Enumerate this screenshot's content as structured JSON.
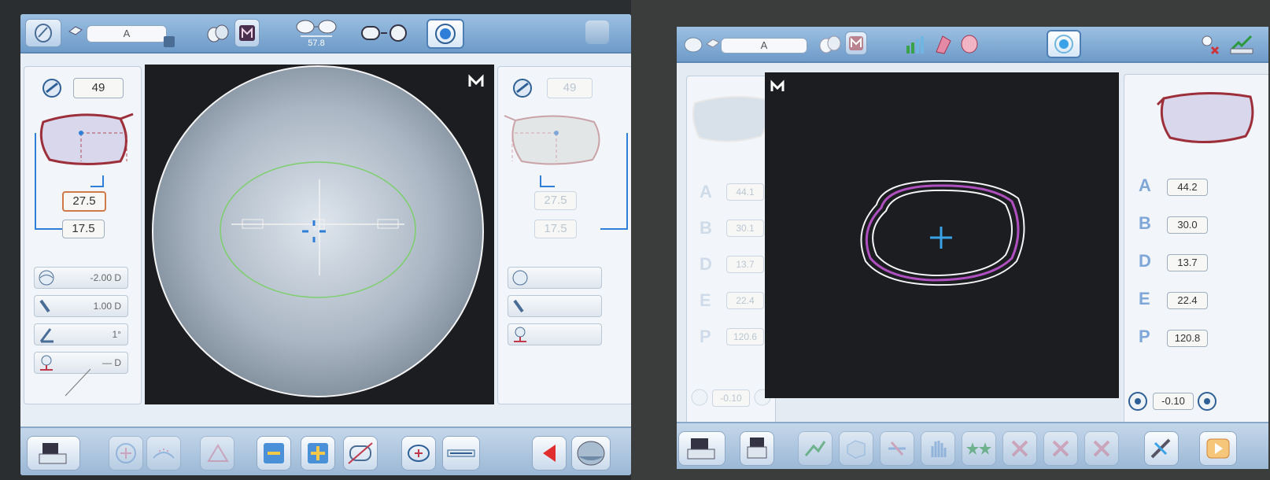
{
  "left_screen": {
    "job_name": "A",
    "frame_width_label": "57.8",
    "diameter_value": "49",
    "height_value": "27.5",
    "half_pd_value": "17.5",
    "right_eye": {
      "diameter_value": "49",
      "height_value": "27.5",
      "half_pd_value": "17.5"
    },
    "prescription": {
      "sphere": "-2.00 D",
      "cylinder": "1.00 D",
      "axis": "1°",
      "prism": "— D"
    }
  },
  "right_screen": {
    "job_name": "A",
    "left_shape": {
      "rows": [
        {
          "letter": "A",
          "value": "44.1"
        },
        {
          "letter": "B",
          "value": "30.1"
        },
        {
          "letter": "D",
          "value": "13.7"
        },
        {
          "letter": "E",
          "value": "22.4"
        },
        {
          "letter": "P",
          "value": "120.6"
        }
      ],
      "size_adjust": "-0.10"
    },
    "right_shape": {
      "rows": [
        {
          "letter": "A",
          "value": "44.2"
        },
        {
          "letter": "B",
          "value": "30.0"
        },
        {
          "letter": "D",
          "value": "13.7"
        },
        {
          "letter": "E",
          "value": "22.4"
        },
        {
          "letter": "P",
          "value": "120.8"
        }
      ],
      "size_adjust": "-0.10"
    }
  },
  "colors": {
    "accent_blue": "#2f7fd9",
    "frame_red": "#9c2f3a",
    "trace_purple": "#b04fc0",
    "highlight_orange": "#d07a4a"
  }
}
